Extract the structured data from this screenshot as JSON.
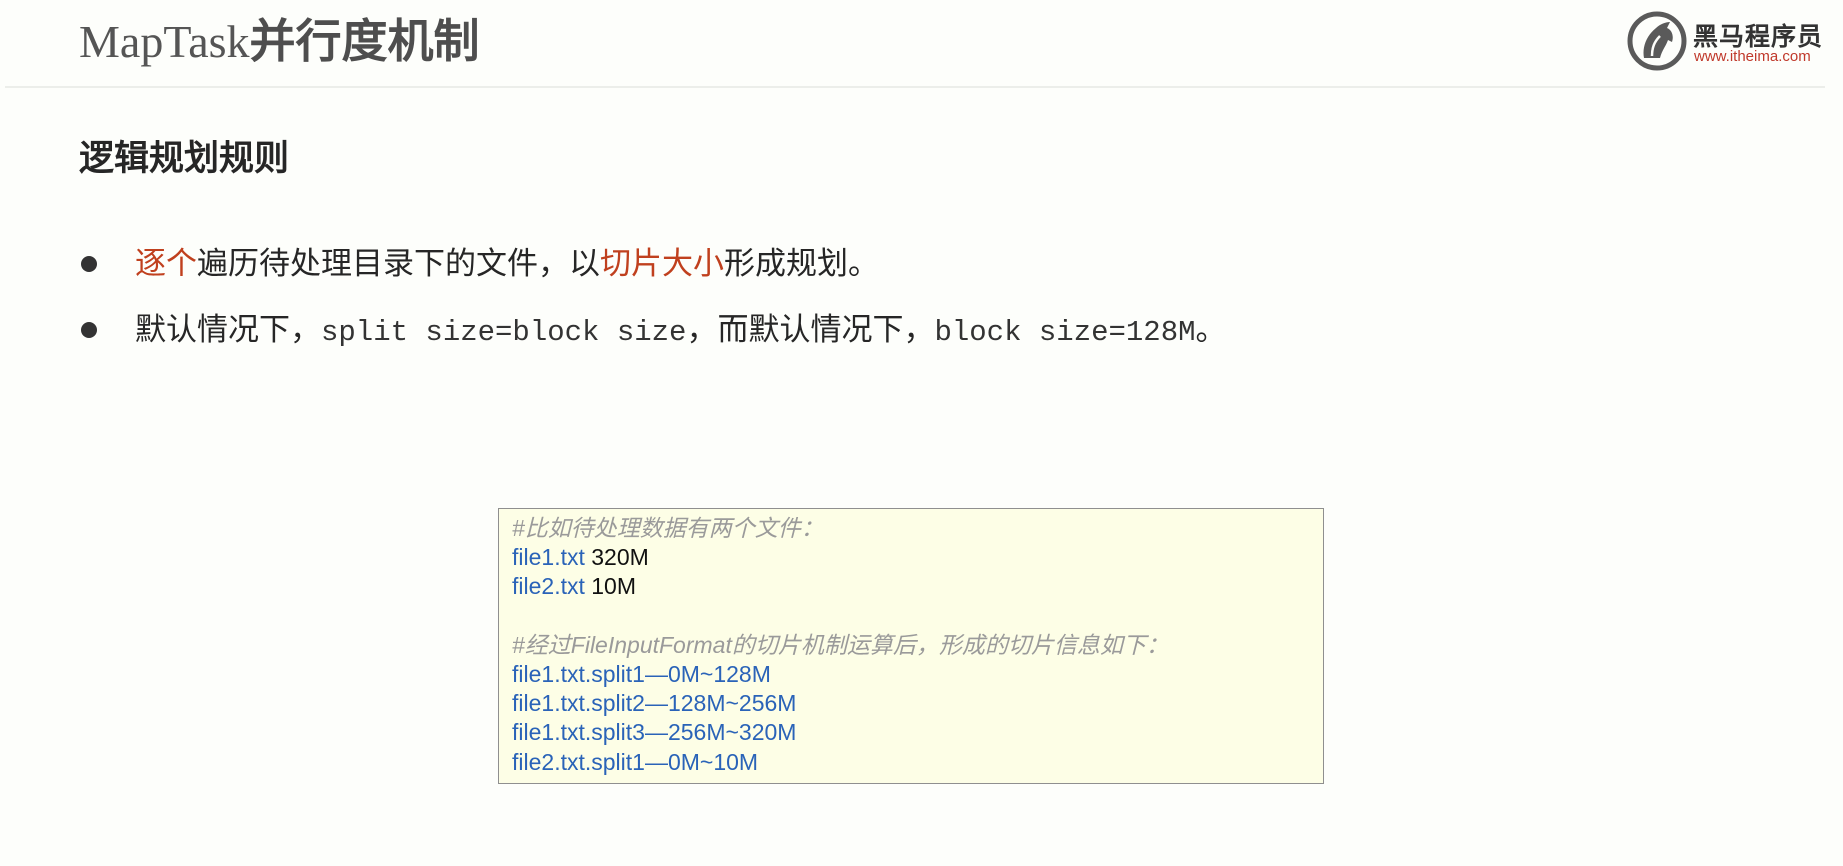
{
  "header": {
    "title_latin": "MapTask",
    "title_cjk": "并行度机制"
  },
  "logo": {
    "name": "黑马程序员",
    "url": "www.itheima.com",
    "icon": "horse-head-logo-icon"
  },
  "section": {
    "heading": "逻辑规划规则"
  },
  "bullets": [
    {
      "parts": [
        {
          "text": "逐个",
          "highlight": true
        },
        {
          "text": "遍历待处理目录下的文件，以",
          "highlight": false
        },
        {
          "text": "切片大小",
          "highlight": true
        },
        {
          "text": "形成规划。",
          "highlight": false
        }
      ]
    },
    {
      "parts": [
        {
          "text": "默认情况下，",
          "mono": false
        },
        {
          "text": "split size=block size",
          "mono": true
        },
        {
          "text": "，而默认情况下，",
          "mono": false
        },
        {
          "text": "block size=128M",
          "mono": true
        },
        {
          "text": "。",
          "mono": false
        }
      ]
    }
  ],
  "code_box": {
    "comment1": "#比如待处理数据有两个文件：",
    "files": [
      {
        "name": "file1.txt",
        "size": "320M"
      },
      {
        "name": "file2.txt",
        "size": "10M"
      }
    ],
    "comment2": "#经过FileInputFormat的切片机制运算后，形成的切片信息如下：",
    "splits": [
      "file1.txt.split1—0M~128M",
      "file1.txt.split2—128M~256M",
      "file1.txt.split3—256M~320M",
      "file2.txt.split1—0M~10M"
    ]
  },
  "colors": {
    "highlight": "#c0401e",
    "file_blue": "#2a63b8",
    "comment_gray": "#9a9a9a",
    "box_background": "#fdfee6"
  }
}
